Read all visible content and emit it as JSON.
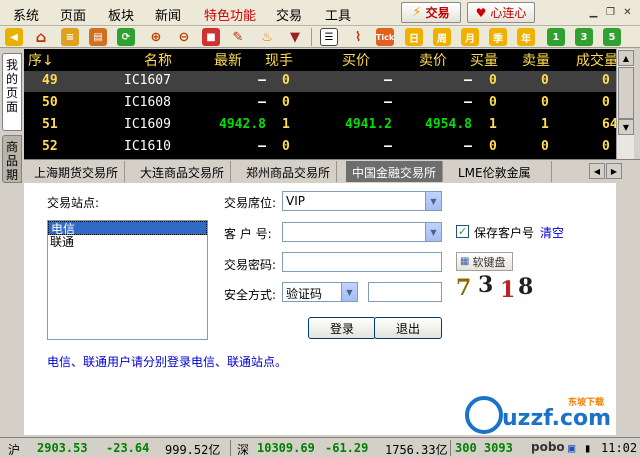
{
  "menubar": {
    "items": [
      "系统",
      "页面",
      "板块",
      "新闻",
      "特色功能",
      "交易",
      "工具"
    ],
    "special_index": 4,
    "trade_button": "交易",
    "lianxin_button": "心连心",
    "window_controls": [
      "minimize-icon",
      "restore-icon",
      "close-icon"
    ]
  },
  "toolbar": {
    "icons": [
      "back-arrow-icon",
      "home-icon",
      "stack-icon",
      "news-icon",
      "refresh-icon",
      "zoom-in-icon",
      "zoom-out-icon",
      "square-icon",
      "pen-icon",
      "alarm-icon",
      "filter-icon",
      "quote-list-icon",
      "kline-icon",
      "tick-icon",
      "day-icon",
      "week-icon",
      "month-icon",
      "season-icon",
      "year-icon",
      "one-min-icon",
      "three-min-icon",
      "five-min-icon"
    ],
    "labels": {
      "tick": "Tick",
      "day": "日",
      "week": "周",
      "month": "月",
      "season": "季",
      "year": "年",
      "m1": "1",
      "m3": "3",
      "m5": "5"
    }
  },
  "quote": {
    "headers": {
      "seq": "序",
      "name": "名称",
      "last": "最新",
      "vol": "现手",
      "bid": "买价",
      "ask": "卖价",
      "bid_qty": "买量",
      "ask_qty": "卖量",
      "turnover": "成交量"
    },
    "rows": [
      {
        "seq": "49",
        "name": "IC1607",
        "last": "—",
        "vol": "0",
        "bid": "—",
        "ask": "—",
        "bid_qty": "0",
        "ask_qty": "0",
        "turnover": "0"
      },
      {
        "seq": "50",
        "name": "IC1608",
        "last": "—",
        "vol": "0",
        "bid": "—",
        "ask": "—",
        "bid_qty": "0",
        "ask_qty": "0",
        "turnover": "0"
      },
      {
        "seq": "51",
        "name": "IC1609",
        "last": "4942.8",
        "vol": "1",
        "bid": "4941.2",
        "ask": "4954.8",
        "bid_qty": "1",
        "ask_qty": "1",
        "turnover": "64"
      },
      {
        "seq": "52",
        "name": "IC1610",
        "last": "—",
        "vol": "0",
        "bid": "—",
        "ask": "—",
        "bid_qty": "0",
        "ask_qty": "0",
        "turnover": "0"
      }
    ]
  },
  "left_tabs": {
    "my_pages": "我的页面",
    "products": "商品期"
  },
  "exchange_tabs": [
    "上海期货交易所",
    "大连商品交易所",
    "郑州商品交易所",
    "中国金融交易所",
    "LME伦敦金属"
  ],
  "exchange_active": 3,
  "login": {
    "site_label": "交易站点:",
    "sites": [
      "电信",
      "联通"
    ],
    "seat_label": "交易席位:",
    "seat_value": "VIP",
    "account_label": "客 户 号:",
    "account_value": "",
    "save_account_label": "保存客户号",
    "clear_label": "清空",
    "password_label": "交易密码:",
    "keyboard_button": "软键盘",
    "security_label": "安全方式:",
    "security_value": "验证码",
    "captcha_code": "7318",
    "login_button": "登录",
    "exit_button": "退出",
    "note": "电信、联通用户请分别登录电信、联通站点。",
    "watermark": "uzzf.com",
    "watermark_sub": "东坡下载"
  },
  "status": {
    "sh_label": "沪",
    "sh_index": "2903.53",
    "sh_change": "-23.64",
    "sh_amount": "999.52亿",
    "sz_label": "深",
    "sz_index": "10309.69",
    "sz_change": "-61.29",
    "sz_amount": "1756.33亿",
    "cy_partial": "300  3093",
    "brand": "pobo",
    "time": "11:02"
  },
  "colors": {
    "quote_bg": "#000000",
    "quote_header": "#ffdc50",
    "price_green": "#00e000",
    "link_blue": "#0000cc",
    "special_red": "#d00000"
  }
}
